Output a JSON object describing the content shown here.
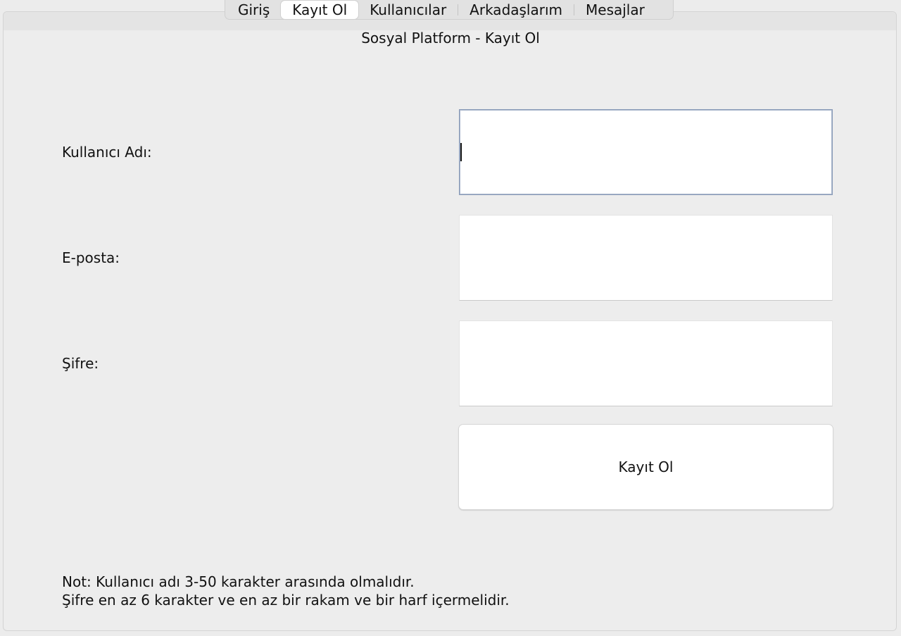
{
  "tabs": [
    {
      "label": "Giriş",
      "selected": false
    },
    {
      "label": "Kayıt Ol",
      "selected": true
    },
    {
      "label": "Kullanıcılar",
      "selected": false
    },
    {
      "label": "Arkadaşlarım",
      "selected": false
    },
    {
      "label": "Mesajlar",
      "selected": false
    }
  ],
  "form": {
    "title": "Sosyal Platform - Kayıt Ol",
    "username_label": "Kullanıcı Adı:",
    "username_value": "",
    "email_label": "E-posta:",
    "email_value": "",
    "password_label": "Şifre:",
    "password_value": "",
    "submit_label": "Kayıt Ol"
  },
  "notes": {
    "line1": "Not: Kullanıcı adı 3-50 karakter arasında olmalıdır.",
    "line2": "Şifre en az 6 karakter ve en az bir rakam ve bir harf içermelidir."
  },
  "colors": {
    "background": "#ececec",
    "focus_border": "#8a9bb8",
    "field_bg": "#ffffff"
  }
}
